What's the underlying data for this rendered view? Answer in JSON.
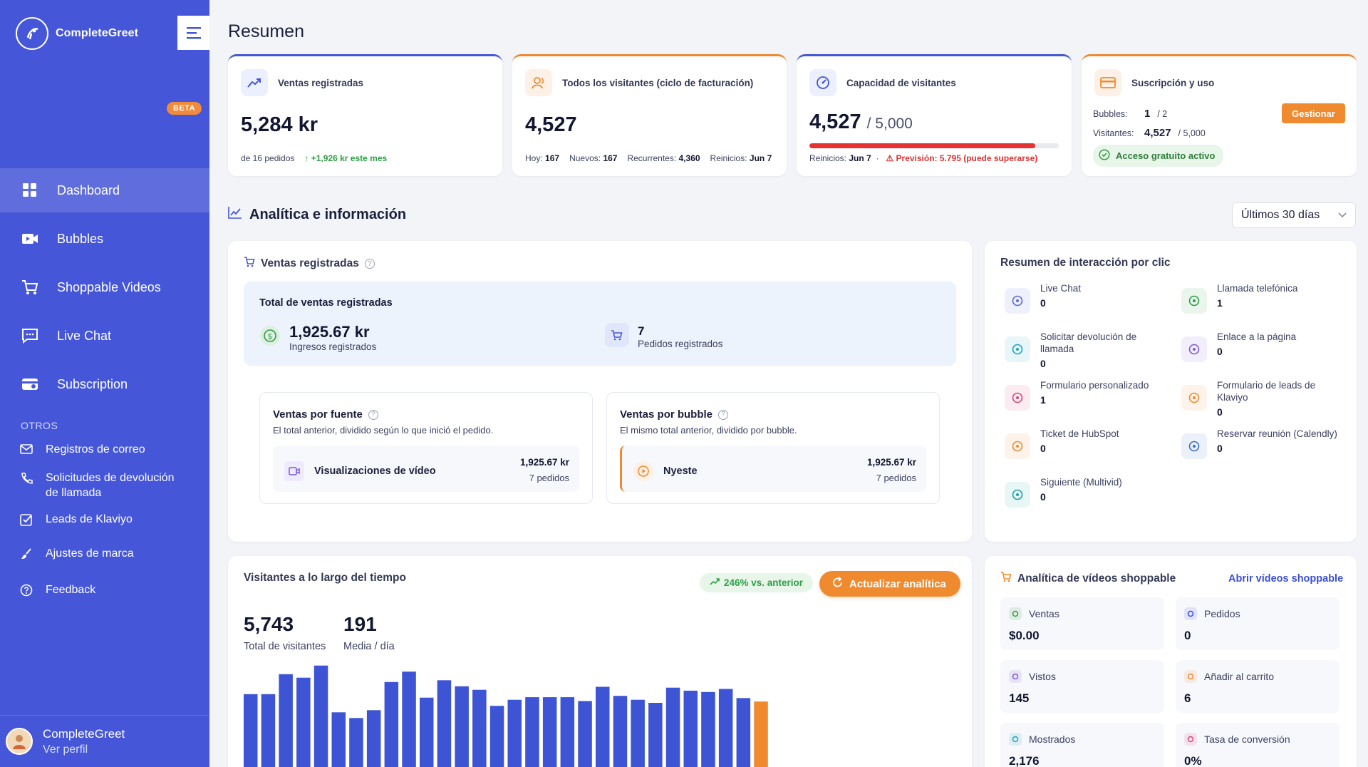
{
  "brand": {
    "name": "CompleteGreet"
  },
  "sidebar": {
    "nav": [
      {
        "label": "Dashboard",
        "icon": "grid-icon"
      },
      {
        "label": "Bubbles",
        "icon": "video-icon"
      },
      {
        "label": "Shoppable Videos",
        "icon": "cart-icon",
        "badge": "BETA"
      },
      {
        "label": "Live Chat",
        "icon": "chat-icon"
      },
      {
        "label": "Subscription",
        "icon": "card-icon"
      }
    ],
    "others_title": "OTROS",
    "others": [
      {
        "label": "Registros de correo"
      },
      {
        "label": "Solicitudes de devolución de llamada"
      },
      {
        "label": "Leads de Klaviyo"
      },
      {
        "label": "Ajustes de marca"
      },
      {
        "label": "Feedback"
      }
    ],
    "profile": {
      "name": "CompleteGreet",
      "link": "Ver perfil"
    }
  },
  "page": {
    "title": "Resumen"
  },
  "stats": {
    "sales": {
      "title": "Ventas registradas",
      "value": "5,284 kr",
      "orders": "de 16 pedidos",
      "delta": "+1,926 kr este mes"
    },
    "visitors": {
      "title": "Todos los visitantes (ciclo de facturación)",
      "value": "4,527",
      "today_label": "Hoy:",
      "today": "167",
      "new_label": "Nuevos:",
      "new": "167",
      "returning_label": "Recurrentes:",
      "returning": "4,360",
      "reset_label": "Reinicios:",
      "reset": "Jun 7"
    },
    "capacity": {
      "title": "Capacidad de visitantes",
      "value": "4,527",
      "limit": "/ 5,000",
      "used_fraction": 0.9054,
      "reset_label": "Reinicios:",
      "reset": "Jun 7",
      "forecast": "Previsión: 5.795 (puede superarse)"
    },
    "subscription": {
      "title": "Suscripción y uso",
      "bubbles_label": "Bubbles:",
      "bubbles": "1",
      "bubbles_limit": "/ 2",
      "visitors_label": "Visitantes:",
      "visitors": "4,527",
      "visitors_limit": "/ 5,000",
      "manage_label": "Gestionar",
      "free_label": "Acceso gratuito activo"
    }
  },
  "analytics": {
    "title": "Analítica e información",
    "range": "Últimos 30 días",
    "sales_card": {
      "title": "Ventas registradas",
      "total_title": "Total de ventas registradas",
      "revenue": "1,925.67 kr",
      "revenue_label": "Ingresos registrados",
      "orders": "7",
      "orders_label": "Pedidos registrados",
      "by_source": {
        "title": "Ventas por fuente",
        "desc": "El total anterior, dividido según lo que inició el pedido.",
        "row_label": "Visualizaciones de vídeo",
        "row_value": "1,925.67 kr",
        "row_orders": "7 pedidos"
      },
      "by_bubble": {
        "title": "Ventas por bubble",
        "desc": "El mismo total anterior, dividido por bubble.",
        "row_label": "Nyeste",
        "row_value": "1,925.67 kr",
        "row_orders": "7 pedidos"
      }
    },
    "interaction": {
      "title": "Resumen de interacción por clic",
      "items": [
        {
          "label": "Live Chat",
          "value": "0",
          "color": "#5b6bdc"
        },
        {
          "label": "Llamada telefónica",
          "value": "1",
          "color": "#2f9e44"
        },
        {
          "label": "Solicitar devolución de llamada",
          "value": "0",
          "color": "#1ca3c4"
        },
        {
          "label": "Enlace a la página",
          "value": "0",
          "color": "#7b5bdc"
        },
        {
          "label": "Formulario personalizado",
          "value": "1",
          "color": "#d6467a"
        },
        {
          "label": "Formulario de leads de Klaviyo",
          "value": "0",
          "color": "#ef8a2e"
        },
        {
          "label": "Ticket de HubSpot",
          "value": "0",
          "color": "#ef8a2e"
        },
        {
          "label": "Reservar reunión (Calendly)",
          "value": "0",
          "color": "#3b6fd4"
        },
        {
          "label": "Siguiente (Multivid)",
          "value": "0",
          "color": "#1ca3a3"
        }
      ]
    },
    "visitors_card": {
      "title": "Visitantes a lo largo del tiempo",
      "delta": "246% vs. anterior",
      "refresh": "Actualizar analítica",
      "total": "5,743",
      "total_label": "Total de visitantes",
      "avg": "191",
      "avg_label": "Media / día"
    },
    "shoppable": {
      "title": "Analítica de vídeos shoppable",
      "link": "Abrir vídeos shoppable",
      "items": [
        {
          "label": "Ventas",
          "value": "$0.00",
          "color": "#2f9e44"
        },
        {
          "label": "Pedidos",
          "value": "0",
          "color": "#3b4fd4"
        },
        {
          "label": "Vistos",
          "value": "145",
          "color": "#7b5bdc"
        },
        {
          "label": "Añadir al carrito",
          "value": "6",
          "color": "#ef8a2e"
        },
        {
          "label": "Mostrados",
          "value": "2,176",
          "color": "#1ca3c4"
        },
        {
          "label": "Tasa de conversión",
          "value": "0%",
          "color": "#d6467a"
        }
      ]
    }
  },
  "chart_data": {
    "type": "bar",
    "title": "",
    "values": [
      168,
      168,
      214,
      206,
      234,
      126,
      113,
      131,
      196,
      220,
      160,
      200,
      186,
      178,
      141,
      155,
      161,
      161,
      161,
      152,
      185,
      164,
      155,
      148,
      183,
      176,
      173,
      180,
      159,
      151
    ],
    "ylim": [
      0,
      240
    ],
    "colors": {
      "default": "#3d54d4",
      "last": "#ef8a2e"
    }
  }
}
